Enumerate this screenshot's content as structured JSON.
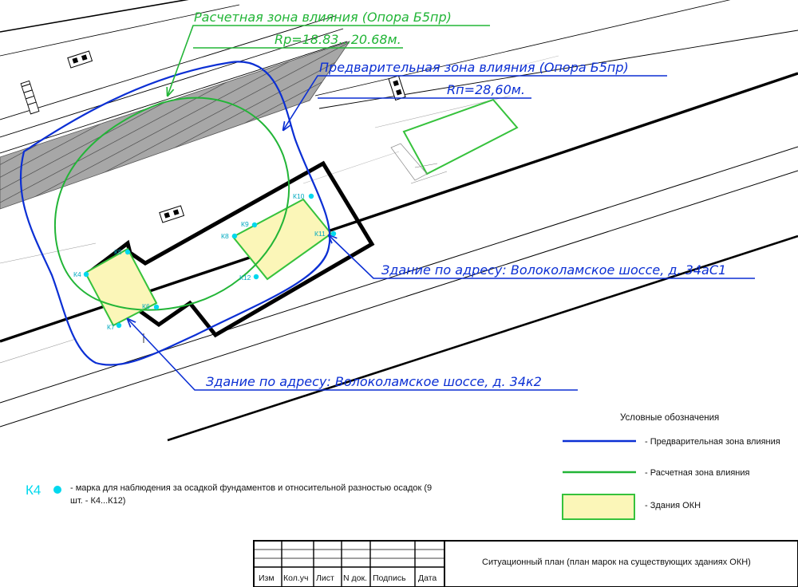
{
  "callouts": {
    "calc_zone_title": "Расчетная зона влияния (Опора Б5пр)",
    "calc_zone_radius": "Rр=18.83...20.68м.",
    "prelim_zone_title": "Предварительная зона влияния (Опора Б5пр)",
    "prelim_zone_radius": "Rп=28,60м.",
    "building_a": "Здание по адресу: Волоколамское шоссе, д. 34аС1",
    "building_b": "Здание по адресу: Волоколамское шоссе, д. 34к2"
  },
  "markers": {
    "k4": "К4",
    "k5": "К5",
    "k6": "К6",
    "k7": "К7",
    "k8": "К8",
    "k9": "К9",
    "k10": "К10",
    "k11": "К11",
    "k12": "К12"
  },
  "legend": {
    "title": "Условные обозначения",
    "prelim": "- Предварительная зона влияния",
    "calc": "- Расчетная зона влияния",
    "okn": "- Здания ОКН"
  },
  "marker_note": {
    "symbol": "К4",
    "line1": "- марка для наблюдения за осадкой фундаментов и относительной разностью осадок (9",
    "line2": "шт. - К4...К12)"
  },
  "title_block": {
    "headers": [
      "Изм",
      "Кол.уч",
      "Лист",
      "N док.",
      "Подпись",
      "Дата"
    ],
    "drawing_title": "Ситуационный план (план марок на существующих зданиях ОКН)"
  },
  "colors": {
    "preliminary_zone": "#0b2fd4",
    "calculated_zone": "#22b537",
    "okn_fill": "#fbf6b8",
    "okn_stroke": "#36c23c",
    "marker": "#00d8ee"
  }
}
